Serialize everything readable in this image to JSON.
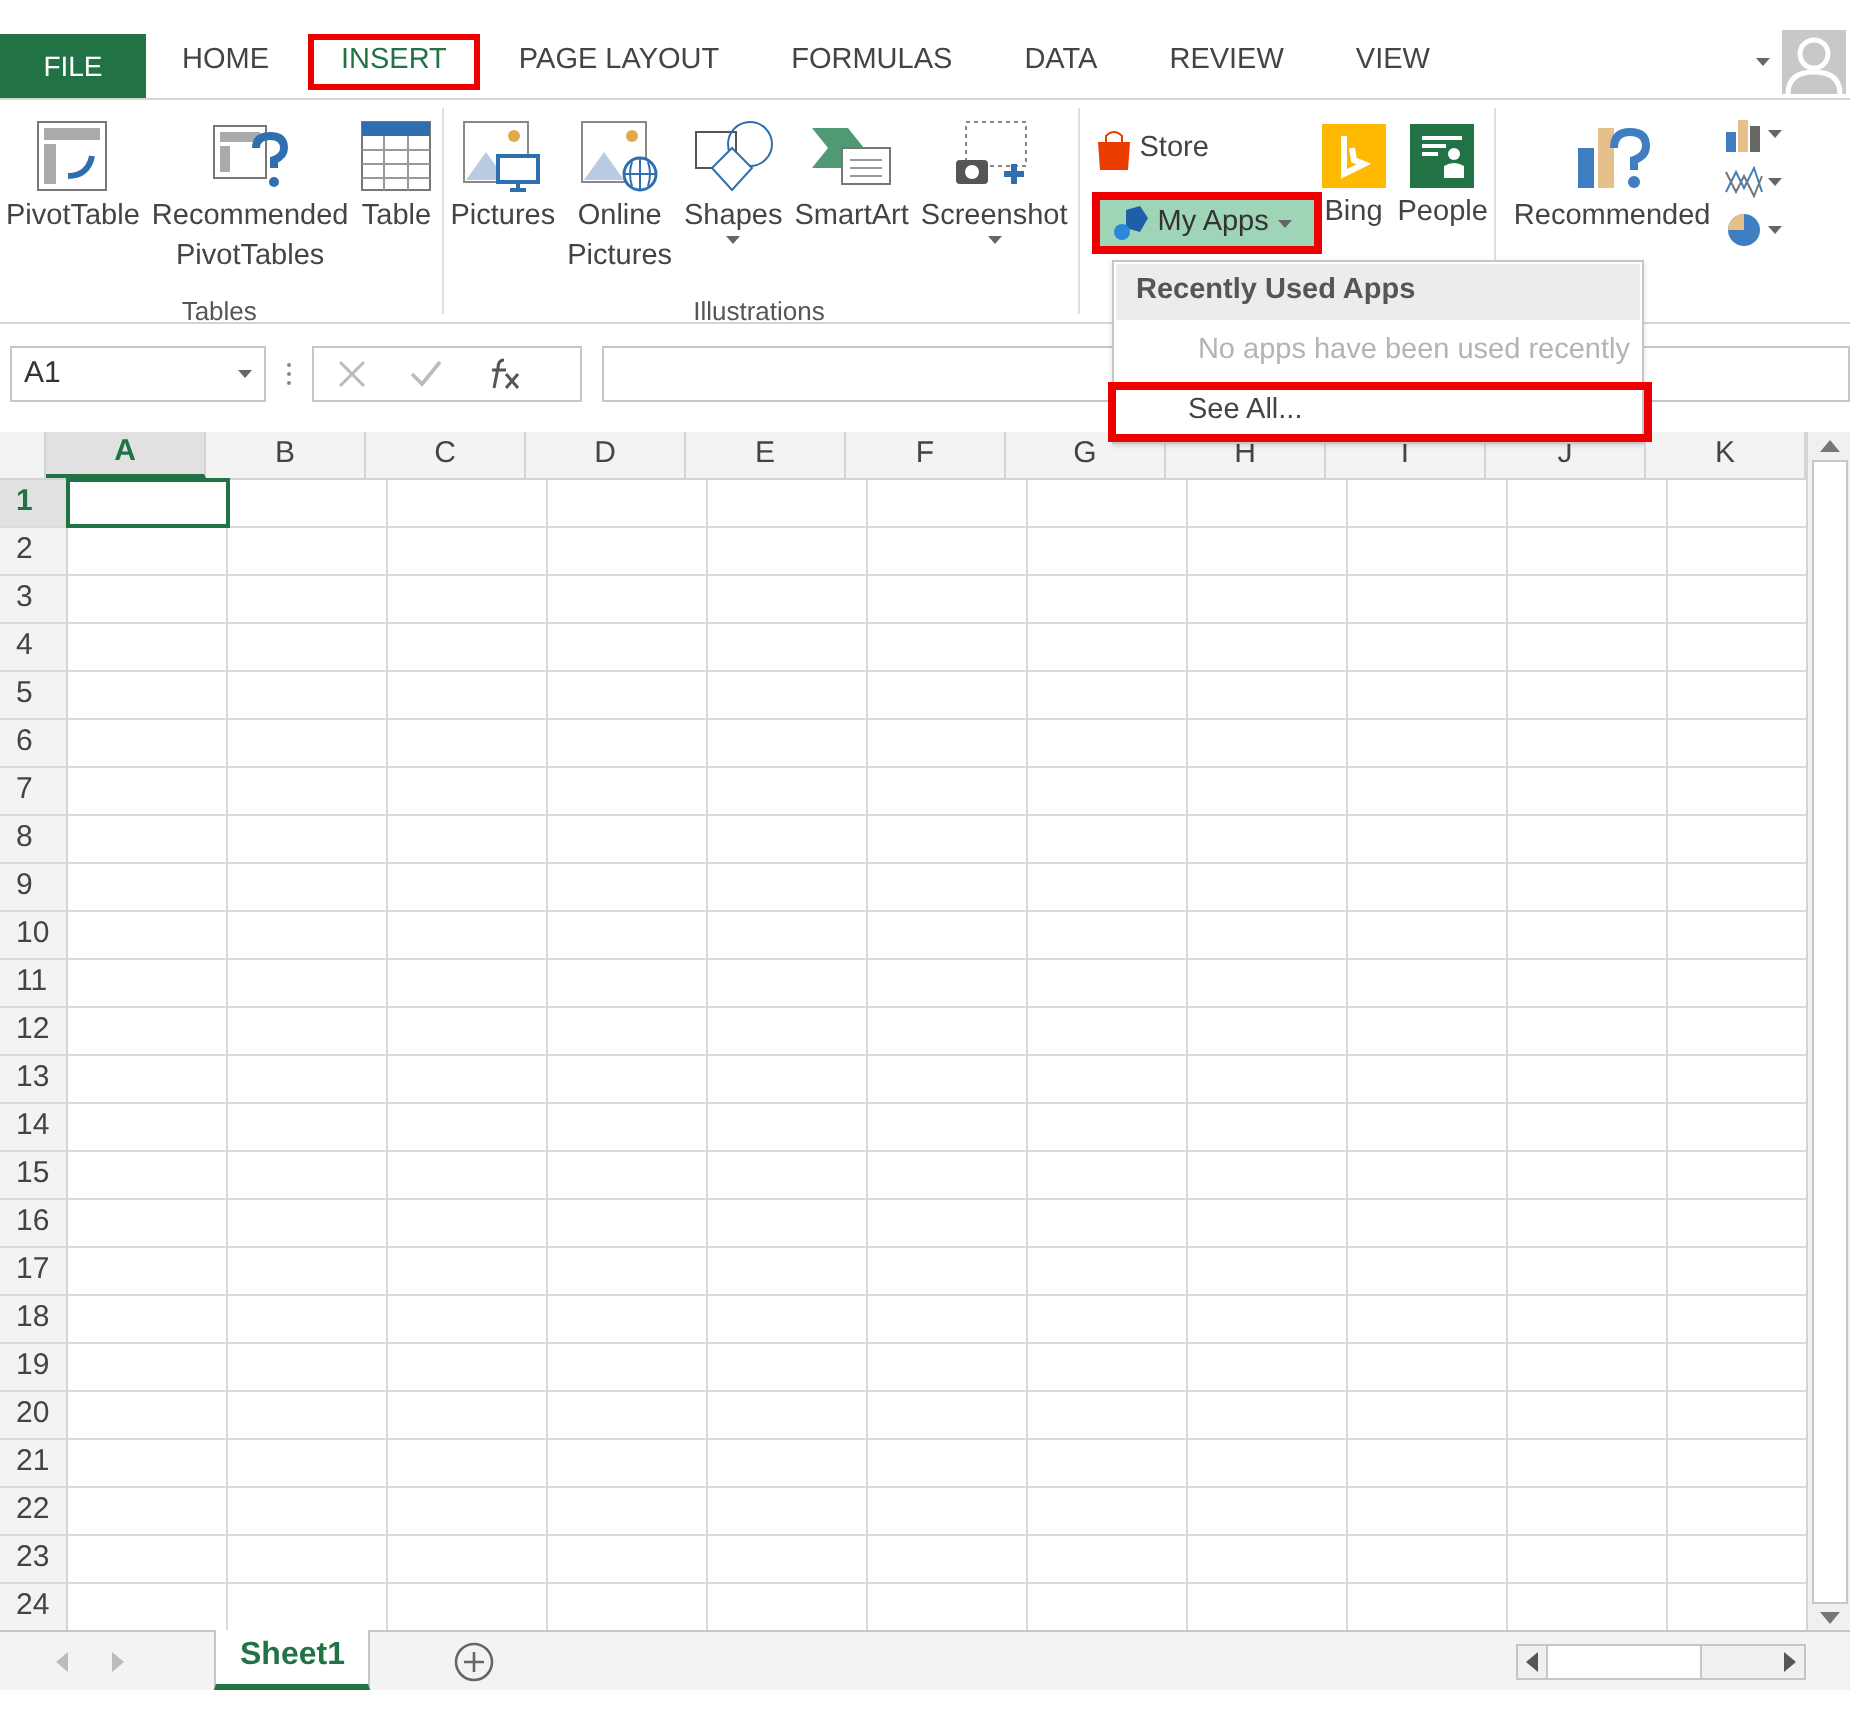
{
  "tabs": [
    {
      "label": "FILE",
      "kind": "file",
      "selected": false,
      "highlighted": false
    },
    {
      "label": "HOME",
      "kind": "tab",
      "selected": false,
      "highlighted": false
    },
    {
      "label": "INSERT",
      "kind": "tab",
      "selected": true,
      "highlighted": true
    },
    {
      "label": "PAGE LAYOUT",
      "kind": "tab",
      "selected": false,
      "highlighted": false
    },
    {
      "label": "FORMULAS",
      "kind": "tab",
      "selected": false,
      "highlighted": false
    },
    {
      "label": "DATA",
      "kind": "tab",
      "selected": false,
      "highlighted": false
    },
    {
      "label": "REVIEW",
      "kind": "tab",
      "selected": false,
      "highlighted": false
    },
    {
      "label": "VIEW",
      "kind": "tab",
      "selected": false,
      "highlighted": false
    }
  ],
  "ribbon": {
    "groups": [
      {
        "label": "Tables",
        "items": [
          {
            "lines": [
              "PivotTable"
            ],
            "has_menu": false
          },
          {
            "lines": [
              "Recommended",
              "PivotTables"
            ],
            "has_menu": false
          },
          {
            "lines": [
              "Table"
            ],
            "has_menu": false
          }
        ]
      },
      {
        "label": "Illustrations",
        "items": [
          {
            "lines": [
              "Pictures"
            ],
            "has_menu": false
          },
          {
            "lines": [
              "Online",
              "Pictures"
            ],
            "has_menu": false
          },
          {
            "lines": [
              "Shapes"
            ],
            "has_menu": true
          },
          {
            "lines": [
              "SmartArt"
            ],
            "has_menu": false
          },
          {
            "lines": [
              "Screenshot"
            ],
            "has_menu": true
          }
        ]
      }
    ],
    "apps": {
      "store": "Store",
      "my_apps": {
        "label": "My Apps",
        "pressed": true,
        "highlighted": true
      },
      "items": [
        {
          "lines": [
            "Bing"
          ]
        },
        {
          "lines": [
            "People"
          ]
        }
      ]
    },
    "charts": {
      "items": [
        {
          "lines": [
            "Recommended"
          ],
          "has_menu": false
        }
      ]
    }
  },
  "apps_menu": {
    "header": "Recently Used Apps",
    "items": [
      {
        "label": "No apps have been used recently",
        "disabled": true,
        "highlighted": false
      },
      {
        "label": "See All...",
        "disabled": false,
        "highlighted": true
      }
    ]
  },
  "formula_bar": {
    "name_box": "A1"
  },
  "sheet": {
    "columns": [
      {
        "label": "A",
        "selected": true
      },
      {
        "label": "B",
        "selected": false
      },
      {
        "label": "C",
        "selected": false
      },
      {
        "label": "D",
        "selected": false
      },
      {
        "label": "E",
        "selected": false
      },
      {
        "label": "F",
        "selected": false
      },
      {
        "label": "G",
        "selected": false
      },
      {
        "label": "H",
        "selected": false
      },
      {
        "label": "I",
        "selected": false
      },
      {
        "label": "J",
        "selected": false
      },
      {
        "label": "K",
        "selected": false
      }
    ],
    "rows": [
      {
        "label": "1",
        "selected": true
      },
      {
        "label": "2",
        "selected": false
      },
      {
        "label": "3",
        "selected": false
      },
      {
        "label": "4",
        "selected": false
      },
      {
        "label": "5",
        "selected": false
      },
      {
        "label": "6",
        "selected": false
      },
      {
        "label": "7",
        "selected": false
      },
      {
        "label": "8",
        "selected": false
      },
      {
        "label": "9",
        "selected": false
      },
      {
        "label": "10",
        "selected": false
      },
      {
        "label": "11",
        "selected": false
      },
      {
        "label": "12",
        "selected": false
      },
      {
        "label": "13",
        "selected": false
      },
      {
        "label": "14",
        "selected": false
      },
      {
        "label": "15",
        "selected": false
      },
      {
        "label": "16",
        "selected": false
      },
      {
        "label": "17",
        "selected": false
      },
      {
        "label": "18",
        "selected": false
      },
      {
        "label": "19",
        "selected": false
      },
      {
        "label": "20",
        "selected": false
      },
      {
        "label": "21",
        "selected": false
      },
      {
        "label": "22",
        "selected": false
      },
      {
        "label": "23",
        "selected": false
      },
      {
        "label": "24",
        "selected": false
      }
    ]
  },
  "sheet_tabs": [
    {
      "label": "Sheet1",
      "selected": true
    }
  ]
}
